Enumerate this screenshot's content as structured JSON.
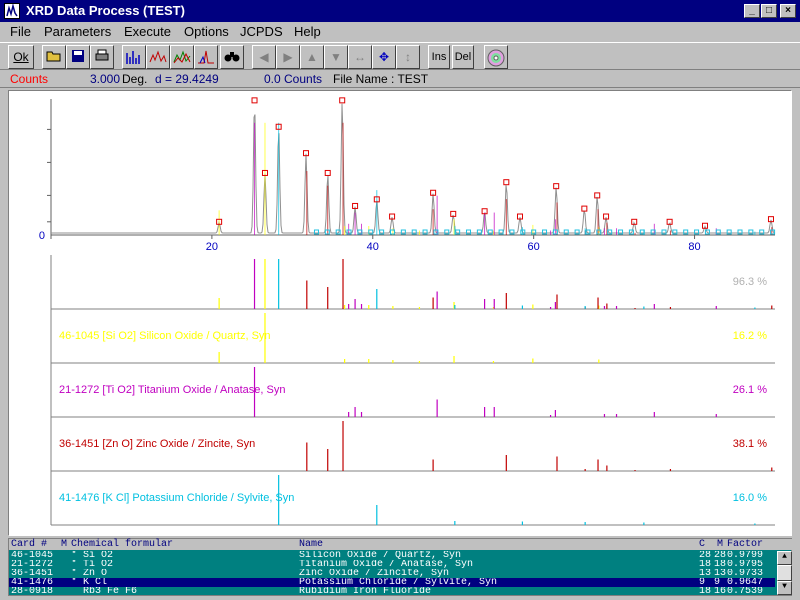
{
  "window": {
    "title": "XRD Data Process (TEST)"
  },
  "menu": [
    "File",
    "Parameters",
    "Execute",
    "Options",
    "JCPDS",
    "Help"
  ],
  "toolbar": {
    "ok": "Ok",
    "ins": "Ins",
    "del": "Del"
  },
  "status": {
    "mode": "Counts",
    "value": "3.000",
    "deg_label": "Deg.",
    "d": "d = 29.4249",
    "counts": "0.0 Counts",
    "file": "File Name : TEST"
  },
  "chart_data": {
    "type": "line",
    "xlim": [
      0,
      90
    ],
    "x_ticks": [
      "0",
      "20",
      "40",
      "60",
      "80"
    ],
    "y_zero_label": "0",
    "ylim": [
      0,
      100
    ],
    "grid": false,
    "pattern_peaks": [
      {
        "x": 20.9,
        "y": 8
      },
      {
        "x": 25.3,
        "y": 100
      },
      {
        "x": 26.6,
        "y": 45
      },
      {
        "x": 28.3,
        "y": 80
      },
      {
        "x": 31.7,
        "y": 60
      },
      {
        "x": 34.4,
        "y": 45
      },
      {
        "x": 36.2,
        "y": 100
      },
      {
        "x": 37.8,
        "y": 20
      },
      {
        "x": 40.5,
        "y": 25
      },
      {
        "x": 42.4,
        "y": 12
      },
      {
        "x": 47.5,
        "y": 30
      },
      {
        "x": 50.0,
        "y": 14
      },
      {
        "x": 53.9,
        "y": 16
      },
      {
        "x": 56.6,
        "y": 38
      },
      {
        "x": 58.3,
        "y": 12
      },
      {
        "x": 62.8,
        "y": 35
      },
      {
        "x": 66.3,
        "y": 18
      },
      {
        "x": 67.9,
        "y": 28
      },
      {
        "x": 69.0,
        "y": 12
      },
      {
        "x": 72.5,
        "y": 8
      },
      {
        "x": 76.9,
        "y": 8
      },
      {
        "x": 81.3,
        "y": 5
      },
      {
        "x": 89.5,
        "y": 10
      }
    ],
    "reference": [
      {
        "card": "46-1045",
        "formula": "[Si O2]",
        "name": "Silicon Oxide / Quartz, Syn",
        "percent": "16.2 %",
        "color": "#ffff00",
        "lines": [
          {
            "x": 20.9,
            "y": 22
          },
          {
            "x": 26.6,
            "y": 100
          },
          {
            "x": 36.5,
            "y": 8
          },
          {
            "x": 39.5,
            "y": 8
          },
          {
            "x": 42.5,
            "y": 6
          },
          {
            "x": 45.8,
            "y": 4
          },
          {
            "x": 50.1,
            "y": 14
          },
          {
            "x": 55.0,
            "y": 4
          },
          {
            "x": 59.9,
            "y": 9
          },
          {
            "x": 68.1,
            "y": 7
          }
        ]
      },
      {
        "card": "21-1272",
        "formula": "[Ti O2]",
        "name": "Titanium Oxide / Anatase, Syn",
        "percent": "26.1 %",
        "color": "#c000c0",
        "lines": [
          {
            "x": 25.3,
            "y": 100
          },
          {
            "x": 37.0,
            "y": 10
          },
          {
            "x": 37.8,
            "y": 20
          },
          {
            "x": 38.6,
            "y": 10
          },
          {
            "x": 48.0,
            "y": 35
          },
          {
            "x": 53.9,
            "y": 20
          },
          {
            "x": 55.1,
            "y": 20
          },
          {
            "x": 62.1,
            "y": 4
          },
          {
            "x": 62.7,
            "y": 14
          },
          {
            "x": 68.8,
            "y": 6
          },
          {
            "x": 70.3,
            "y": 6
          },
          {
            "x": 75.0,
            "y": 10
          },
          {
            "x": 82.7,
            "y": 6
          }
        ]
      },
      {
        "card": "36-1451",
        "formula": "[Zn O]",
        "name": "Zinc Oxide / Zincite, Syn",
        "percent": "38.1 %",
        "color": "#c00000",
        "lines": [
          {
            "x": 31.8,
            "y": 57
          },
          {
            "x": 34.4,
            "y": 44
          },
          {
            "x": 36.3,
            "y": 100
          },
          {
            "x": 47.5,
            "y": 23
          },
          {
            "x": 56.6,
            "y": 32
          },
          {
            "x": 62.9,
            "y": 29
          },
          {
            "x": 66.4,
            "y": 4
          },
          {
            "x": 68.0,
            "y": 23
          },
          {
            "x": 69.1,
            "y": 11
          },
          {
            "x": 72.6,
            "y": 2
          },
          {
            "x": 77.0,
            "y": 4
          },
          {
            "x": 89.6,
            "y": 7
          }
        ]
      },
      {
        "card": "41-1476",
        "formula": "[K Cl]",
        "name": "Potassium Chloride / Sylvite, Syn",
        "percent": "16.0 %",
        "color": "#00c0e0",
        "lines": [
          {
            "x": 28.3,
            "y": 100
          },
          {
            "x": 40.5,
            "y": 40
          },
          {
            "x": 50.2,
            "y": 8
          },
          {
            "x": 58.6,
            "y": 7
          },
          {
            "x": 66.4,
            "y": 6
          },
          {
            "x": 73.7,
            "y": 5
          },
          {
            "x": 87.5,
            "y": 3
          }
        ]
      }
    ],
    "combined_percent": "96.3 %"
  },
  "cardlist": {
    "headers": {
      "card": "Card #",
      "m": "M",
      "formula": "Chemical formular",
      "name": "Name",
      "c": "C",
      "mm": "M",
      "factor": "Factor"
    },
    "rows": [
      {
        "card": "46-1045",
        "m": "*",
        "formula": "Si O2",
        "name": "Silicon Oxide / Quartz, Syn",
        "c": "28",
        "mm": "28",
        "factor": "0.9799"
      },
      {
        "card": "21-1272",
        "m": "*",
        "formula": "Ti O2",
        "name": "Titanium Oxide / Anatase, Syn",
        "c": "18",
        "mm": "18",
        "factor": "0.9795"
      },
      {
        "card": "36-1451",
        "m": "*",
        "formula": "Zn O",
        "name": "Zinc Oxide / Zincite, Syn",
        "c": "13",
        "mm": "13",
        "factor": "0.9733"
      },
      {
        "card": "41-1476",
        "m": "*",
        "formula": "K Cl",
        "name": "Potassium Chloride / Sylvite, Syn",
        "c": "9",
        "mm": "9",
        "factor": "0.9647"
      },
      {
        "card": "28-0918",
        "m": "",
        "formula": "Rb3 Fe F6",
        "name": "Rubidium Iron Fluoride",
        "c": "18",
        "mm": "16",
        "factor": "0.7539"
      }
    ],
    "selected": 3
  }
}
